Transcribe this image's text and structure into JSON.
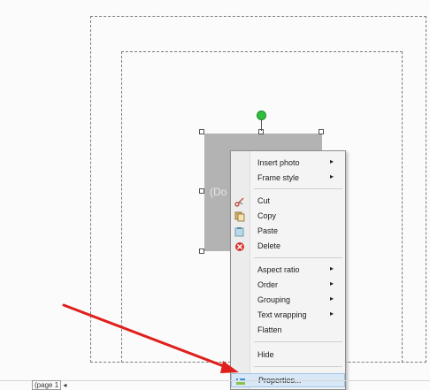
{
  "photo_frame": {
    "label": "(Do"
  },
  "context_menu": {
    "items": [
      {
        "label": "Insert photo",
        "submenu": true,
        "icon": ""
      },
      {
        "label": "Frame style",
        "submenu": true,
        "icon": ""
      },
      {
        "label": "Cut",
        "submenu": false,
        "icon": "scissors-icon"
      },
      {
        "label": "Copy",
        "submenu": false,
        "icon": "copy-icon"
      },
      {
        "label": "Paste",
        "submenu": false,
        "icon": "paste-icon"
      },
      {
        "label": "Delete",
        "submenu": false,
        "icon": "delete-icon"
      },
      {
        "label": "Aspect ratio",
        "submenu": true,
        "icon": ""
      },
      {
        "label": "Order",
        "submenu": true,
        "icon": ""
      },
      {
        "label": "Grouping",
        "submenu": true,
        "icon": ""
      },
      {
        "label": "Text wrapping",
        "submenu": true,
        "icon": ""
      },
      {
        "label": "Flatten",
        "submenu": false,
        "icon": ""
      },
      {
        "label": "Hide",
        "submenu": false,
        "icon": ""
      },
      {
        "label": "Properties...",
        "submenu": false,
        "icon": "properties-icon",
        "highlighted": true
      }
    ],
    "submenu_glyph": "▸"
  },
  "bottom_bar": {
    "page_label": "(page",
    "page_number": "1",
    "arrow": "◂"
  },
  "colors": {
    "annotation_arrow": "#e0201c",
    "rotate_handle": "#2fbf3c",
    "highlight": "#d8e8f6"
  }
}
